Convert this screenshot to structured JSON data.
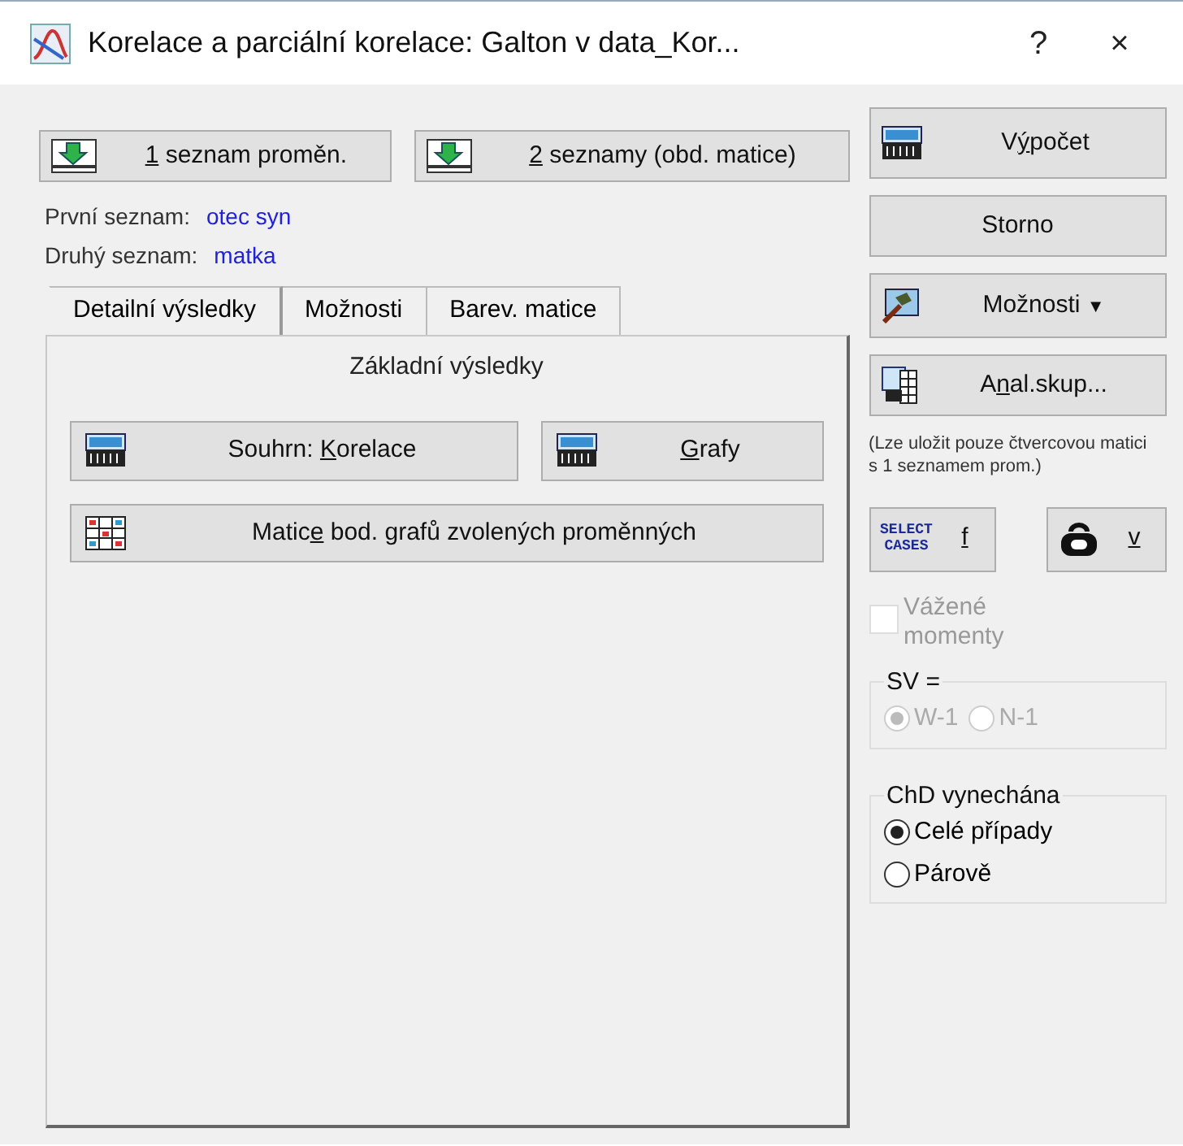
{
  "window": {
    "title": "Korelace a parciální korelace: Galton v data_Kor...",
    "help": "?",
    "close": "×"
  },
  "list_buttons": [
    {
      "label": {
        "key": "1",
        "end": " seznam proměn."
      }
    },
    {
      "label": {
        "key": "2",
        "end": " seznamy (obd. matice)"
      }
    }
  ],
  "lists": [
    {
      "label": "První seznam:",
      "value": "otec syn"
    },
    {
      "label": "Druhý seznam:",
      "value": "matka"
    }
  ],
  "tabs": [
    {
      "label": "Detailní výsledky",
      "selected": false
    },
    {
      "label": "Možnosti",
      "selected": false
    },
    {
      "label": "Barev. matice",
      "selected": false
    },
    {
      "label": "Základní výsledky",
      "selected": true
    }
  ],
  "panel_buttons": [
    {
      "kind": "summ",
      "label": {
        "start": "Souhrn: ",
        "key": "K",
        "end": "orelace"
      }
    },
    {
      "kind": "summ",
      "label": {
        "key": "G",
        "end": "rafy"
      }
    },
    {
      "kind": "matrix",
      "label": {
        "start": "Matic",
        "key": "e",
        "end": " bod. grafů zvolených proměnných"
      }
    }
  ],
  "side": {
    "compute": {
      "label": {
        "start": "V",
        "key": "ý",
        "end": "počet"
      }
    },
    "cancel": {
      "label": {
        "start": "Storno"
      }
    },
    "options": {
      "label": {
        "start": "Možnosti"
      },
      "caret": "▼"
    },
    "groups": {
      "label": {
        "start": "A",
        "key": "n",
        "end": "al.skup..."
      }
    },
    "note": "(Lze uložit pouze čtvercovou matici s 1 seznamem prom.)",
    "select_cases": {
      "caption_lines": [
        "SELECT",
        "CASES"
      ],
      "label": {
        "key": "f"
      }
    },
    "weight": {
      "label": {
        "key": "v"
      }
    },
    "weighted": {
      "label": "Vážené momenty",
      "checked": false,
      "disabled": true
    },
    "sv": {
      "title": "SV =",
      "options": [
        {
          "label": "W-1",
          "selected": true,
          "disabled": true
        },
        {
          "label": "N-1",
          "selected": false,
          "disabled": true
        }
      ]
    },
    "md": {
      "title": "ChD vynechána",
      "options": [
        {
          "label": "Celé případy",
          "selected": true,
          "disabled": false
        },
        {
          "label": "Párově",
          "selected": false,
          "disabled": false
        }
      ]
    }
  }
}
